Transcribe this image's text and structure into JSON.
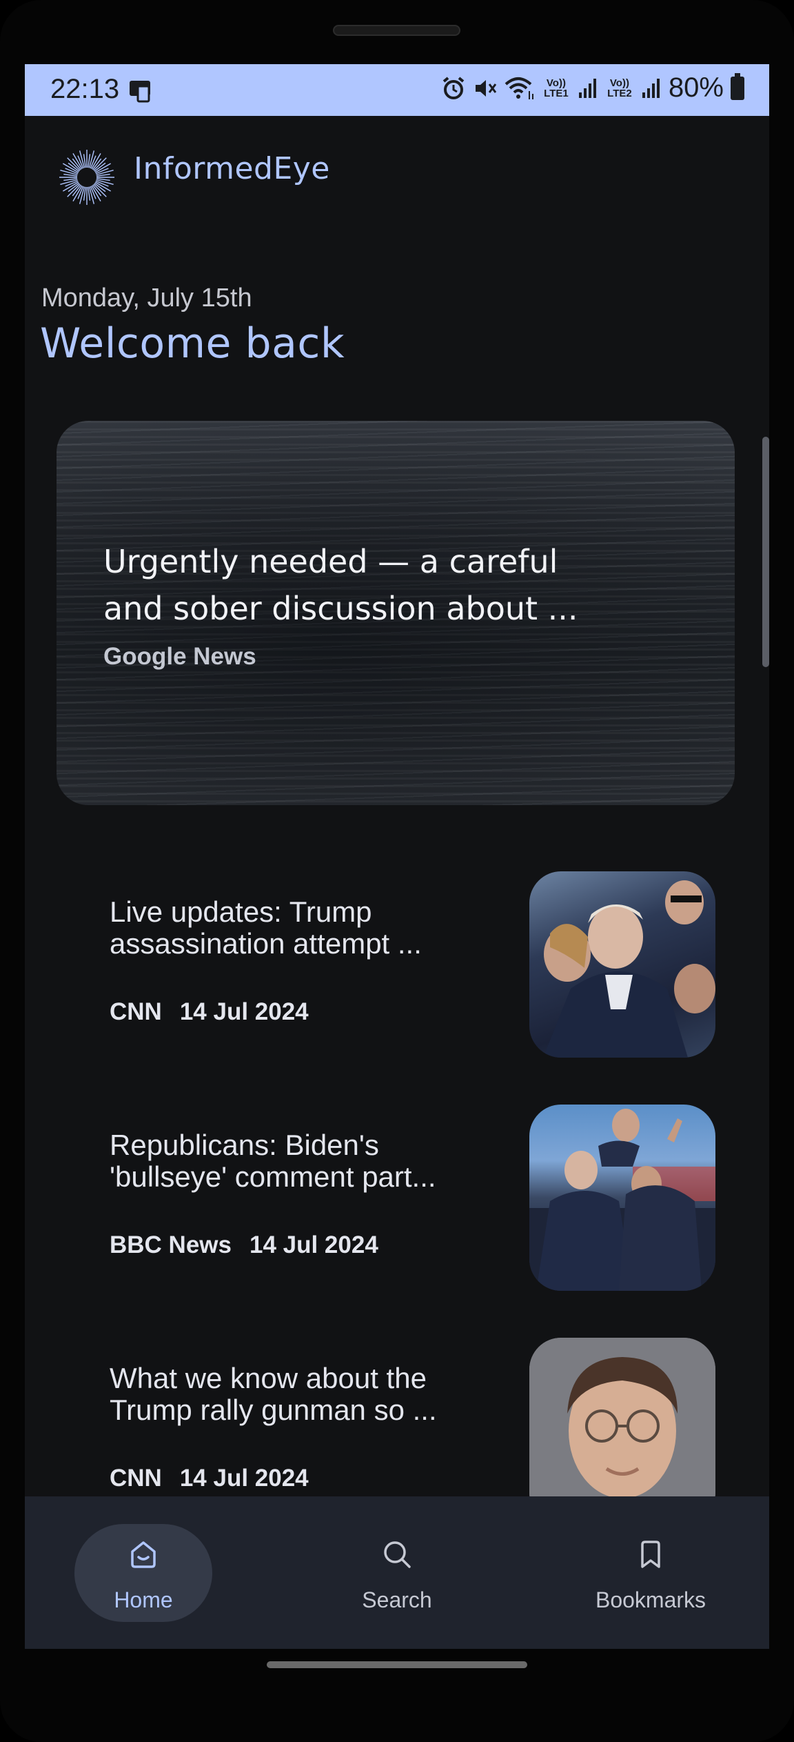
{
  "status_bar": {
    "time": "22:13",
    "volte1": "Vo)) LTE1",
    "volte2": "Vo)) LTE2",
    "battery": "80%"
  },
  "header": {
    "app_name": "InformedEye",
    "logo_icon": "sunburst-logo-icon"
  },
  "greeting": {
    "date": "Monday, July 15th",
    "title": "Welcome back"
  },
  "featured": {
    "title_line1": "Urgently needed — a careful",
    "title_line2": "and sober discussion about ...",
    "source": "Google News"
  },
  "articles": [
    {
      "title_line1": "Live updates: Trump",
      "title_line2": "assassination attempt ...",
      "source": "CNN",
      "date": "14 Jul 2024"
    },
    {
      "title_line1": "Republicans: Biden's",
      "title_line2": "'bullseye' comment part...",
      "source": "BBC News",
      "date": "14 Jul 2024"
    },
    {
      "title_line1": "What we know about the",
      "title_line2": "Trump rally gunman so ...",
      "source": "CNN",
      "date": "14 Jul 2024"
    }
  ],
  "bottom_nav": {
    "items": [
      {
        "label": "Home",
        "icon": "home-icon",
        "active": true
      },
      {
        "label": "Search",
        "icon": "search-icon",
        "active": false
      },
      {
        "label": "Bookmarks",
        "icon": "bookmark-icon",
        "active": false
      }
    ]
  },
  "colors": {
    "accent": "#b0c6ff",
    "background": "#111214",
    "nav_background": "#1f232d",
    "nav_active_pill": "#343a48"
  }
}
